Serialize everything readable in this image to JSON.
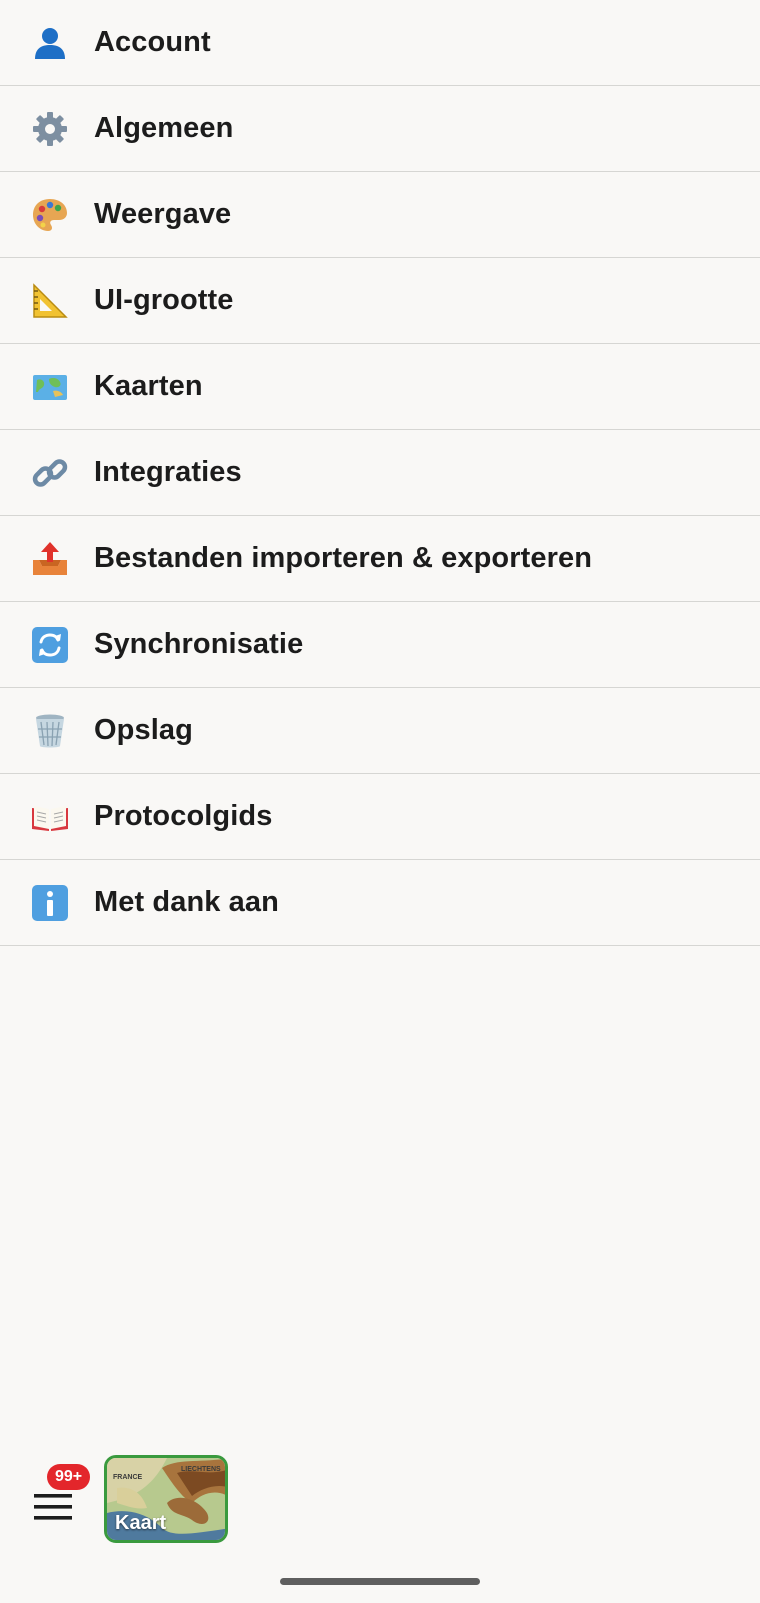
{
  "settings": {
    "items": [
      {
        "label": "Account",
        "icon": "person-icon"
      },
      {
        "label": "Algemeen",
        "icon": "gear-icon"
      },
      {
        "label": "Weergave",
        "icon": "palette-icon"
      },
      {
        "label": "UI-grootte",
        "icon": "triangle-ruler-icon"
      },
      {
        "label": "Kaarten",
        "icon": "world-map-icon"
      },
      {
        "label": "Integraties",
        "icon": "link-icon"
      },
      {
        "label": "Bestanden importeren & exporteren",
        "icon": "outbox-tray-icon"
      },
      {
        "label": "Synchronisatie",
        "icon": "sync-arrows-icon"
      },
      {
        "label": "Opslag",
        "icon": "wastebasket-icon"
      },
      {
        "label": "Protocolgids",
        "icon": "open-book-icon"
      },
      {
        "label": "Met dank aan",
        "icon": "info-icon"
      }
    ]
  },
  "bottom_bar": {
    "menu_icon": "hamburger-menu-icon",
    "badge_count": "99+",
    "map_tile": {
      "label": "Kaart",
      "region_labels": [
        "FRANCE",
        "LIECHTENS"
      ]
    }
  },
  "colors": {
    "background": "#f9f8f6",
    "divider": "#d6d6d3",
    "badge": "#e3262b",
    "map_tile_border": "#3a9a3e"
  }
}
